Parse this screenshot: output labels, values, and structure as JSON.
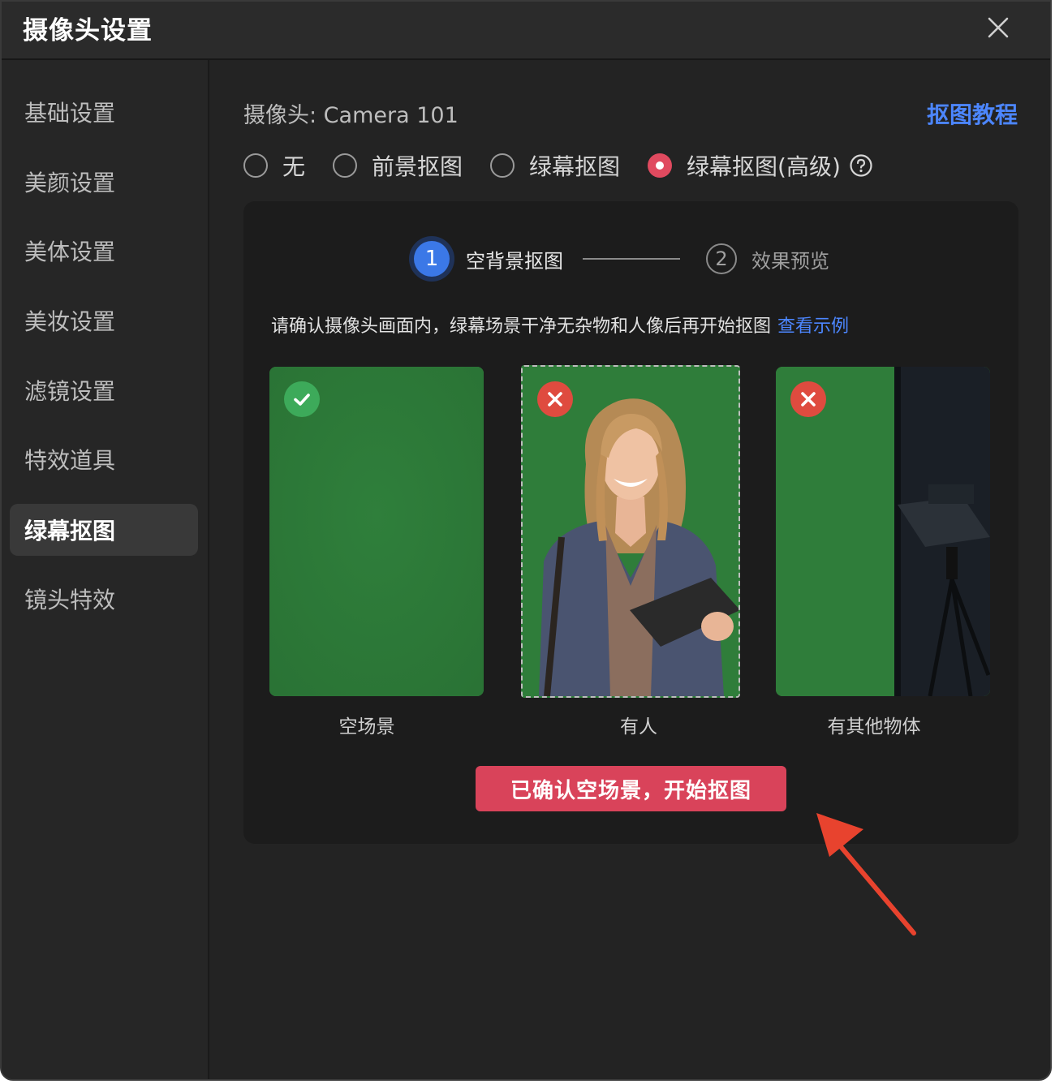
{
  "window": {
    "title": "摄像头设置"
  },
  "sidebar": {
    "items": [
      {
        "label": "基础设置"
      },
      {
        "label": "美颜设置"
      },
      {
        "label": "美体设置"
      },
      {
        "label": "美妆设置"
      },
      {
        "label": "滤镜设置"
      },
      {
        "label": "特效道具"
      },
      {
        "label": "绿幕抠图",
        "active": true
      },
      {
        "label": "镜头特效"
      }
    ]
  },
  "main": {
    "camera_label": "摄像头:  Camera 101",
    "tutorial_link": "抠图教程",
    "modes": [
      {
        "label": "无",
        "checked": false
      },
      {
        "label": "前景抠图",
        "checked": false
      },
      {
        "label": "绿幕抠图",
        "checked": false
      },
      {
        "label": "绿幕抠图(高级)",
        "checked": true
      }
    ],
    "steps": [
      {
        "number": "1",
        "label": "空背景抠图",
        "active": true
      },
      {
        "number": "2",
        "label": "效果预览",
        "active": false
      }
    ],
    "instruction": "请确认摄像头画面内，绿幕场景干净无杂物和人像后再开始抠图",
    "example_link": "查看示例",
    "cards": [
      {
        "label": "空场景",
        "status": "ok"
      },
      {
        "label": "有人",
        "status": "bad"
      },
      {
        "label": "有其他物体",
        "status": "bad"
      }
    ],
    "confirm_button": "已确认空场景，开始抠图"
  },
  "colors": {
    "accent_blue": "#3b78e7",
    "link_blue": "#4c86ff",
    "confirm_red": "#d9435a",
    "green_screen": "#2f7d3a"
  },
  "icons": [
    "close-icon",
    "help-icon",
    "check-icon",
    "cross-icon",
    "arrow-annotation"
  ]
}
